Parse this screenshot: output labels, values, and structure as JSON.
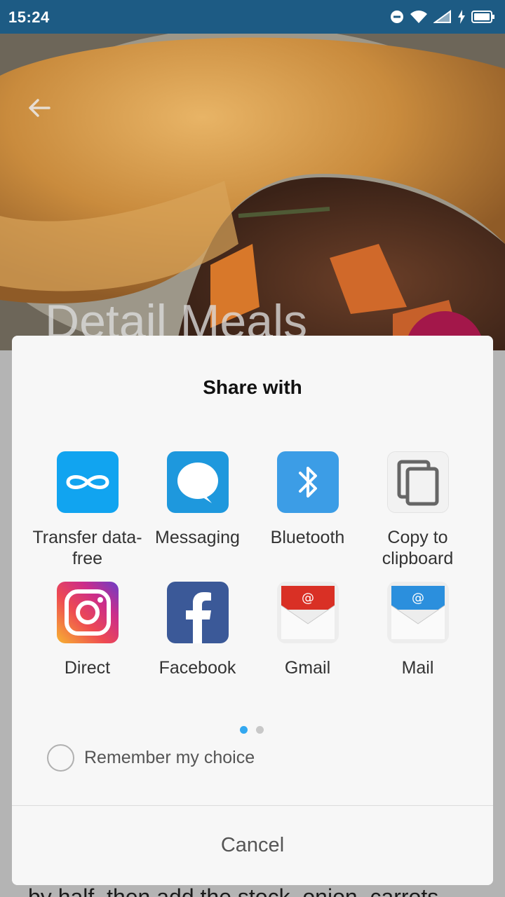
{
  "status_bar": {
    "time": "15:24"
  },
  "hero": {
    "title": "Detail Meals"
  },
  "content": {
    "partial_text": "by half, then add the stock, onion, carrots"
  },
  "sheet": {
    "title": "Share with",
    "apps": [
      {
        "label": "Transfer data-free",
        "icon": "transfer-icon"
      },
      {
        "label": "Messaging",
        "icon": "messaging-icon"
      },
      {
        "label": "Bluetooth",
        "icon": "bluetooth-icon"
      },
      {
        "label": "Copy to clipboard",
        "icon": "copy-icon"
      },
      {
        "label": "Direct",
        "icon": "instagram-icon"
      },
      {
        "label": "Facebook",
        "icon": "facebook-icon"
      },
      {
        "label": "Gmail",
        "icon": "gmail-icon"
      },
      {
        "label": "Mail",
        "icon": "mail-icon"
      }
    ],
    "page_indicator": {
      "current": 1,
      "total": 2
    },
    "remember_label": "Remember my choice",
    "cancel_label": "Cancel"
  },
  "colors": {
    "status_bar": "#1d5b84",
    "fab": "#a3174a",
    "dot_active": "#33a8f0",
    "transfer": "#11a4f0",
    "messaging": "#1e98dd",
    "bluetooth": "#3c9de6",
    "facebook": "#3b5998",
    "gmail_red": "#d93025",
    "mail_blue": "#2b8fdd"
  }
}
